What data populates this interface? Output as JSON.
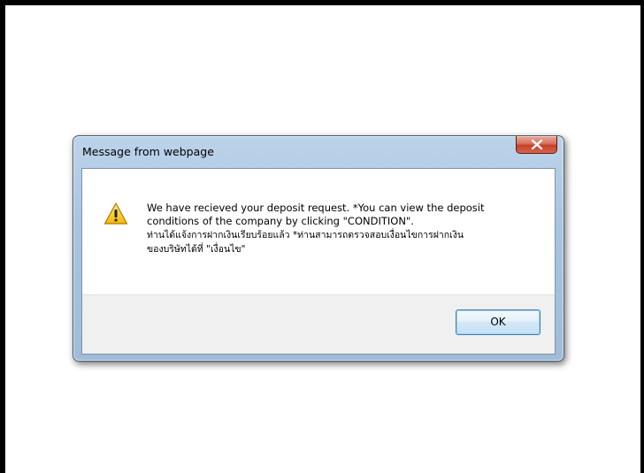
{
  "dialog": {
    "title": "Message from webpage",
    "close_icon": "close-x-icon",
    "message_icon": "warning-icon",
    "message_lines": [
      "We have recieved your deposit request. *You can view the deposit",
      "conditions of the company by clicking \"CONDITION\".",
      "ท่านได้แจ้งการฝากเงินเรียบร้อยแล้ว *ท่านสามารถตรวจสอบเงื่อนไขการฝากเงิน",
      "ของบริษัทได้ที่ \"เงื่อนไข\""
    ],
    "ok_label": "OK"
  },
  "colors": {
    "close_button": "#c5402a",
    "ok_border": "#3c7fb1",
    "frame_glass": "#a9c4e0"
  }
}
